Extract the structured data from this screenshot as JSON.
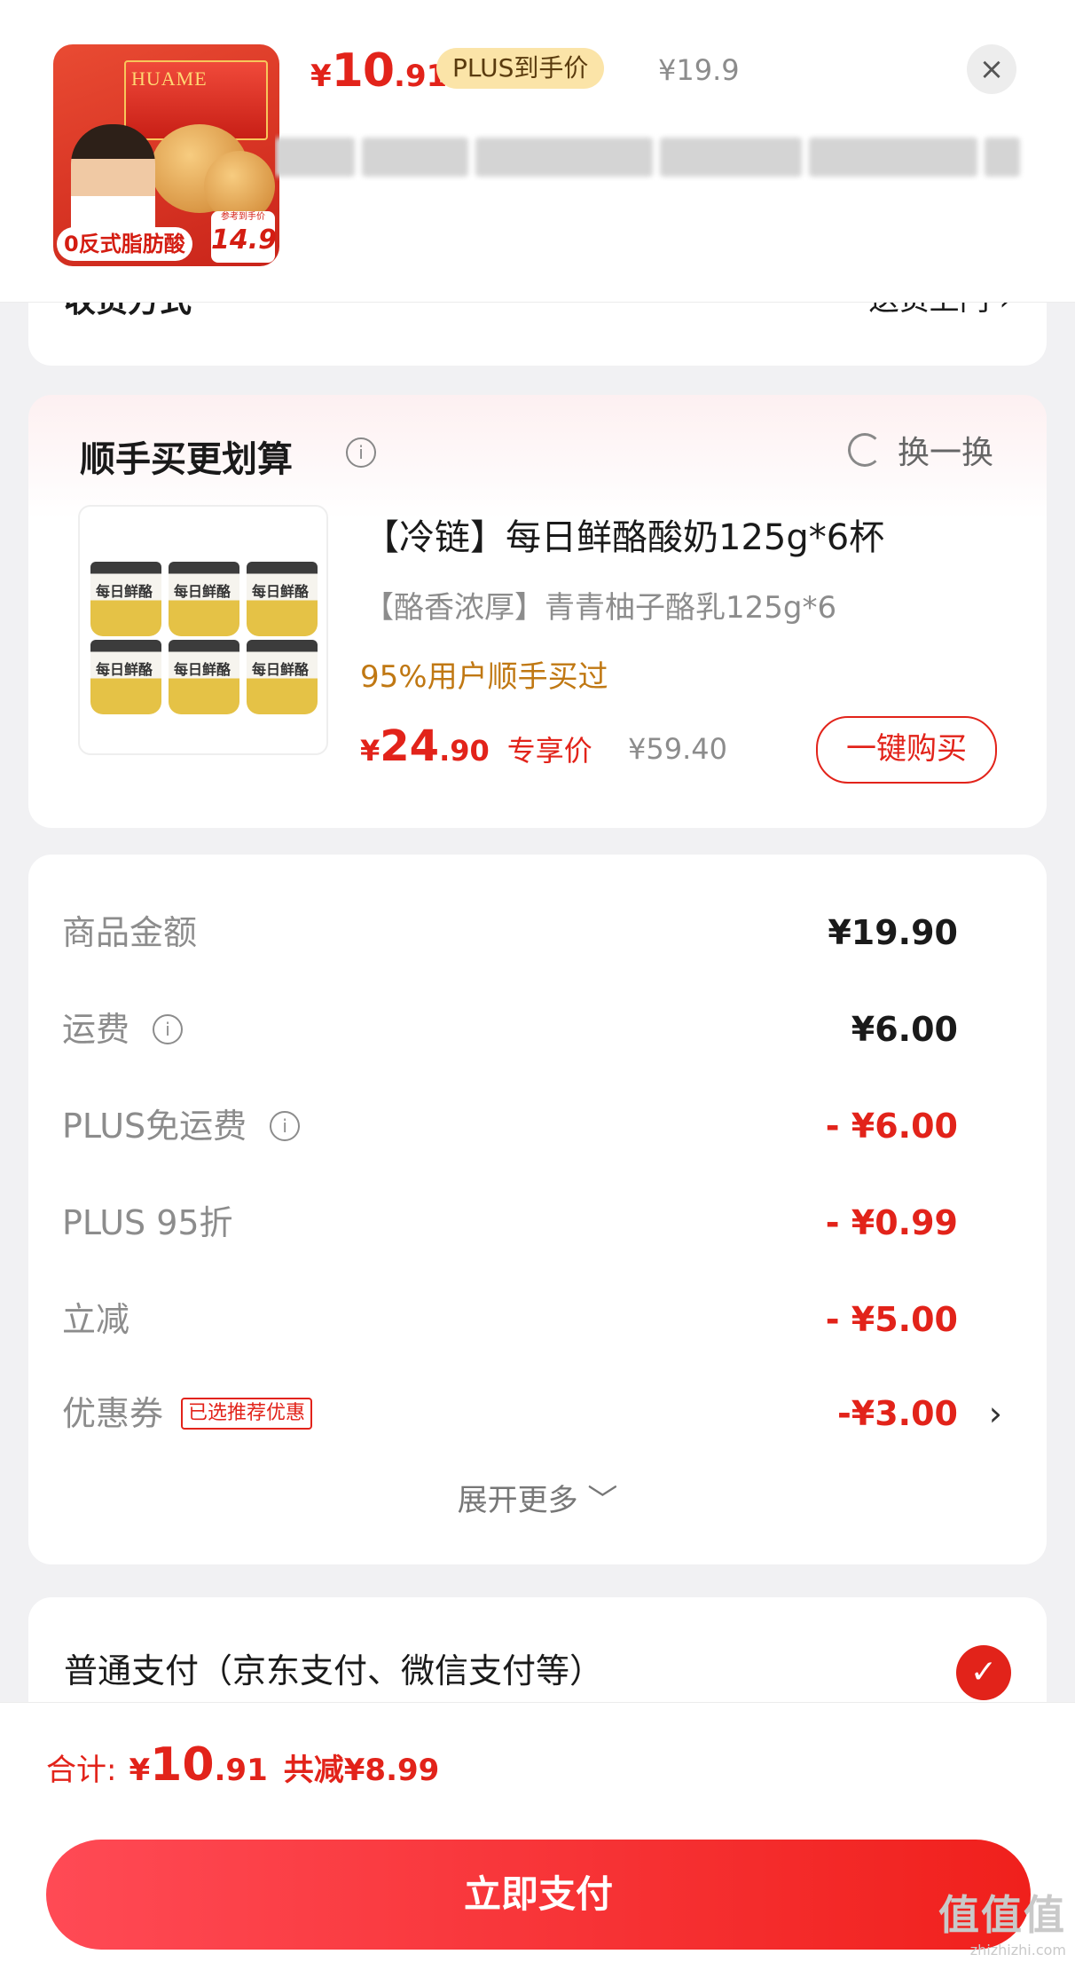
{
  "header": {
    "product_image_texts": {
      "brand": "HUAME",
      "tag": "0反式脂肪酸",
      "badge_small": "参考到手价",
      "badge_price": "14.9"
    },
    "price": {
      "symbol": "¥",
      "integer": "10",
      "decimal": ".91"
    },
    "plus_label": "PLUS到手价",
    "original_price": "¥19.9",
    "close_icon": "×"
  },
  "delivery": {
    "label": "收货方式",
    "value": "送货上门 ›"
  },
  "upsell": {
    "title": "顺手买更划算",
    "swap_label": "换一换",
    "product": {
      "image_cup_text": "每日鲜酪",
      "name": "【冷链】每日鲜酪酸奶125g*6杯",
      "spec": "【酪香浓厚】青青柚子酪乳125g*6",
      "social_proof": "95%用户顺手买过",
      "price": {
        "symbol": "¥",
        "integer": "24",
        "decimal": ".90"
      },
      "price_label": "专享价",
      "original_price": "¥59.40",
      "buy_button": "一键购买"
    }
  },
  "summary": {
    "rows": [
      {
        "label": "商品金额",
        "value": "¥19.90"
      },
      {
        "label": "运费",
        "value": "¥6.00"
      },
      {
        "label": "PLUS免运费",
        "value": "- ¥6.00"
      },
      {
        "label": "PLUS 95折",
        "value": "- ¥0.99"
      },
      {
        "label": "立减",
        "value": "- ¥5.00"
      },
      {
        "label": "优惠券",
        "tag": "已选推荐优惠",
        "value": "-¥3.00",
        "chevron": "›"
      }
    ],
    "expand_label": "展开更多 ﹀"
  },
  "payment": {
    "method_label": "普通支付（京东支付、微信支付等）",
    "check_icon": "✓"
  },
  "footer": {
    "total_label": "合计:",
    "total": {
      "symbol": "¥",
      "integer": "10",
      "decimal": ".91"
    },
    "saved": "共减¥8.99",
    "pay_button": "立即支付"
  },
  "watermark": {
    "main": "值值值",
    "sub": "zhizhizhi.com"
  },
  "colors": {
    "accent": "#e2231a",
    "plus_gold": "#fbe4a8",
    "social": "#c07813"
  }
}
